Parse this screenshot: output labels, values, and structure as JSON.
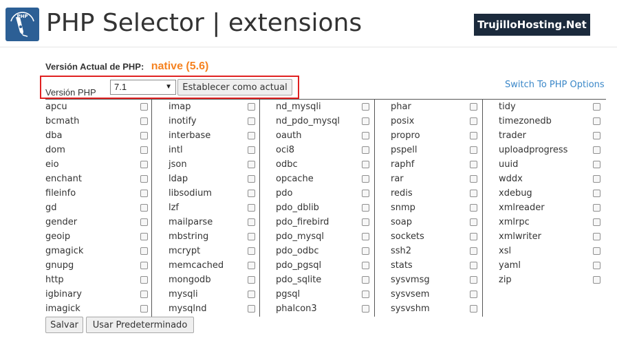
{
  "header": {
    "title": "PHP Selector | extensions",
    "brand": "TrujilloHosting.Net",
    "logo_icon": "php-quill-icon",
    "logo_text": "PHP"
  },
  "current": {
    "label": "Versión Actual de PHP:",
    "value": "native (5.6)"
  },
  "version": {
    "label": "Versión PHP",
    "selected": "7.1",
    "set_button": "Establecer como actual"
  },
  "switch_link": "Switch To PHP Options",
  "columns": [
    [
      "apcu",
      "bcmath",
      "dba",
      "dom",
      "eio",
      "enchant",
      "fileinfo",
      "gd",
      "gender",
      "geoip",
      "gmagick",
      "gnupg",
      "http",
      "igbinary",
      "imagick"
    ],
    [
      "imap",
      "inotify",
      "interbase",
      "intl",
      "json",
      "ldap",
      "libsodium",
      "lzf",
      "mailparse",
      "mbstring",
      "mcrypt",
      "memcached",
      "mongodb",
      "mysqli",
      "mysqlnd"
    ],
    [
      "nd_mysqli",
      "nd_pdo_mysql",
      "oauth",
      "oci8",
      "odbc",
      "opcache",
      "pdo",
      "pdo_dblib",
      "pdo_firebird",
      "pdo_mysql",
      "pdo_odbc",
      "pdo_pgsql",
      "pdo_sqlite",
      "pgsql",
      "phalcon3"
    ],
    [
      "phar",
      "posix",
      "propro",
      "pspell",
      "raphf",
      "rar",
      "redis",
      "snmp",
      "soap",
      "sockets",
      "ssh2",
      "stats",
      "sysvmsg",
      "sysvsem",
      "sysvshm"
    ],
    [
      "tidy",
      "timezonedb",
      "trader",
      "uploadprogress",
      "uuid",
      "wddx",
      "xdebug",
      "xmlreader",
      "xmlrpc",
      "xmlwriter",
      "xsl",
      "yaml",
      "zip"
    ]
  ],
  "buttons": {
    "save": "Salvar",
    "default": "Usar Predeterminado"
  },
  "colors": {
    "accent_orange": "#f58220",
    "link_blue": "#3a87c8",
    "brand_bg": "#1b2a3c",
    "highlight_red": "#e02020",
    "logo_blue": "#2c5f95"
  }
}
